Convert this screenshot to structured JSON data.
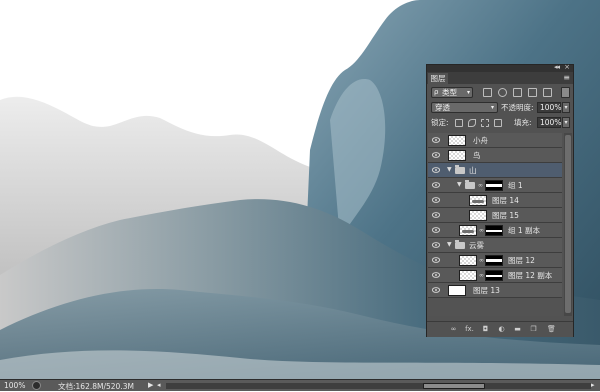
{
  "statusbar": {
    "zoom": "100%",
    "doc_info": "文档:162.8M/520.3M",
    "arrow_right": "▶",
    "arrow_left": "◂",
    "arrow_end": "▸"
  },
  "panel": {
    "tab_title": "图层",
    "collapse_glyph": "◂◂",
    "close_glyph": "×",
    "menu_glyph": "≡",
    "filter": {
      "label": "类型",
      "search_glyph": "ρ",
      "dropdown_glyph": "▾"
    },
    "blend_mode": {
      "label": "穿透",
      "dropdown_glyph": "▾"
    },
    "opacity": {
      "label": "不透明度:",
      "value": "100%",
      "stepper_glyph": "▾"
    },
    "lock_label": "锁定:",
    "fill": {
      "label": "填充:",
      "value": "100%",
      "stepper_glyph": "▾"
    },
    "layers": [
      {
        "name": "小舟",
        "kind": "layer",
        "thumb": "checker",
        "indent": 0
      },
      {
        "name": "鸟",
        "kind": "layer",
        "thumb": "checker",
        "indent": 0
      },
      {
        "name": "山",
        "kind": "group",
        "expanded": true,
        "indent": 0,
        "selected": true
      },
      {
        "name": "组 1",
        "kind": "group",
        "expanded": true,
        "indent": 1,
        "mask": true
      },
      {
        "name": "图层 14",
        "kind": "layer",
        "thumb": "checker-art",
        "indent": 2
      },
      {
        "name": "图层 15",
        "kind": "layer",
        "thumb": "checker",
        "indent": 2
      },
      {
        "name": "组 1 副本",
        "kind": "layer",
        "thumb": "checker-art",
        "indent": 1,
        "mask": true
      },
      {
        "name": "云雾",
        "kind": "group",
        "expanded": true,
        "indent": 0
      },
      {
        "name": "图层 12",
        "kind": "layer",
        "thumb": "checker",
        "indent": 1,
        "mask": true
      },
      {
        "name": "图层 12 副本",
        "kind": "layer",
        "thumb": "checker",
        "indent": 1,
        "mask": true
      },
      {
        "name": "图层 13",
        "kind": "layer",
        "thumb": "white",
        "indent": 0
      }
    ],
    "bottom_icons": [
      "link-icon",
      "fx-icon",
      "mask-icon",
      "adjustment-icon",
      "folder-icon",
      "new-layer-icon",
      "trash-icon"
    ],
    "bottom_glyphs": [
      "∞",
      "fx.",
      "◘",
      "◐",
      "▬",
      "❐",
      "🗑"
    ]
  },
  "colors": {
    "panel_bg": "#525252",
    "selected_row": "#4f5d6f",
    "mountain_blue": "#466e86",
    "mountain_gray": "#bcbcbc"
  }
}
